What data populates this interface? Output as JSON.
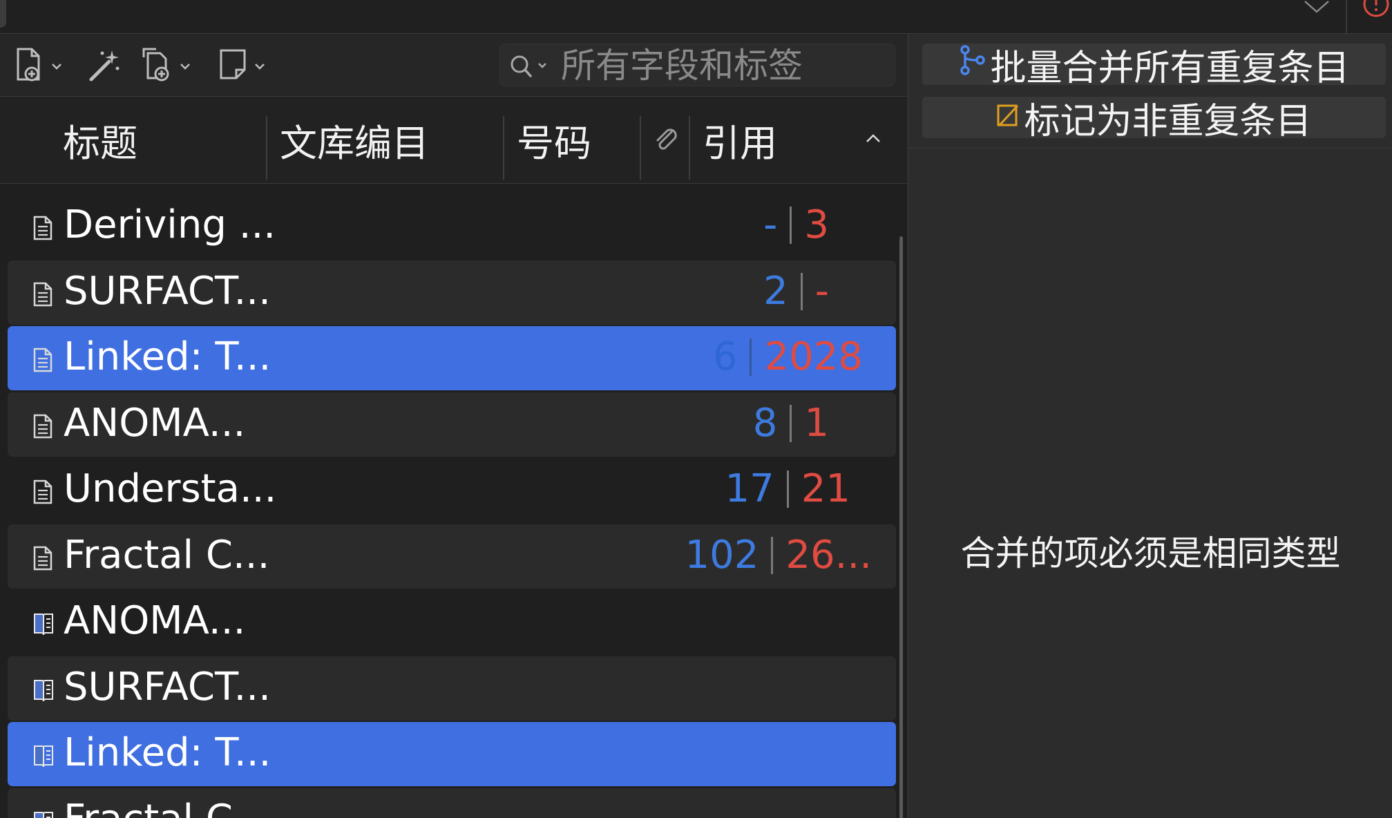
{
  "toolbar": {
    "search_placeholder": "所有字段和标签"
  },
  "columns": {
    "title": "标题",
    "library_catalog": "文库编目",
    "number": "号码",
    "citation": "引用"
  },
  "rows": [
    {
      "title": "Deriving ...",
      "icon": "document-icon",
      "count_blue": "-",
      "count_red": "3",
      "selected": false
    },
    {
      "title": "SURFACT...",
      "icon": "document-icon",
      "count_blue": "2",
      "count_red": "-",
      "selected": false
    },
    {
      "title": "Linked: T...",
      "icon": "document-icon",
      "count_blue": "6",
      "count_red": "2028",
      "selected": true
    },
    {
      "title": "ANOMA...",
      "icon": "document-icon",
      "count_blue": "8",
      "count_red": "1",
      "selected": false
    },
    {
      "title": "Understa...",
      "icon": "document-icon",
      "count_blue": "17",
      "count_red": "21",
      "selected": false
    },
    {
      "title": "Fractal C...",
      "icon": "document-icon",
      "count_blue": "102",
      "count_red": "26...",
      "selected": false
    },
    {
      "title": "ANOMA...",
      "icon": "book-icon",
      "count_blue": "",
      "count_red": "",
      "selected": false
    },
    {
      "title": "SURFACT...",
      "icon": "book-icon",
      "count_blue": "",
      "count_red": "",
      "selected": false
    },
    {
      "title": "Linked: T...",
      "icon": "book-icon",
      "count_blue": "",
      "count_red": "",
      "selected": true
    },
    {
      "title": "Fractal C...",
      "icon": "book-icon",
      "count_blue": "",
      "count_red": "",
      "selected": false
    }
  ],
  "right_pane": {
    "merge_all_button": "批量合并所有重复条目",
    "mark_not_duplicate_button": "标记为非重复条目",
    "message": "合并的项必须是相同类型"
  },
  "colors": {
    "selection": "#3f6fe0",
    "count_blue": "#3d7be0",
    "count_red": "#e04b42",
    "mark_icon": "#e0a020",
    "alert": "#e04b42"
  }
}
